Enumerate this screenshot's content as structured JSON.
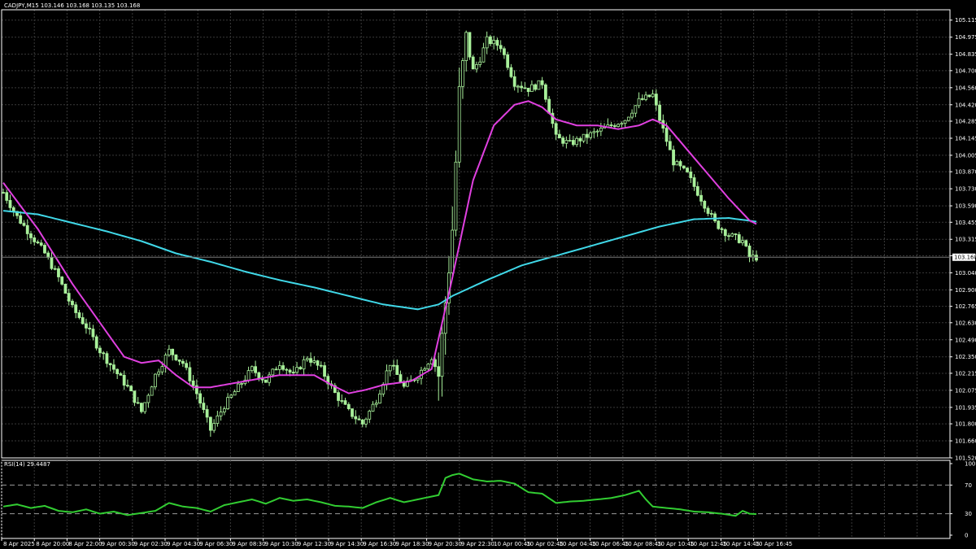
{
  "window": {
    "symbol_line": "CADJPY,M15  103.146 103.168 103.135 103.168",
    "rsi_line": "RSI(14) 29.4487",
    "last_price_label": "103.168"
  },
  "colors": {
    "background": "#000000",
    "grid": "#3a3a3a",
    "frame": "#ffffff",
    "candle": "#a8f09a",
    "sma_fast": "#e040e0",
    "sma_slow": "#40d8e8",
    "rsi": "#32cd32",
    "text": "#ffffff"
  },
  "chart_data": [
    {
      "type": "candlestick",
      "title": "CADJPY,M15",
      "ohlc_header": {
        "open": 103.146,
        "high": 103.168,
        "low": 103.135,
        "close": 103.168
      },
      "y_ticks": [
        "105.115",
        "104.975",
        "104.835",
        "104.700",
        "104.560",
        "104.420",
        "104.285",
        "104.145",
        "104.005",
        "103.870",
        "103.730",
        "103.590",
        "103.455",
        "103.315",
        "103.180",
        "103.040",
        "102.900",
        "102.765",
        "102.630",
        "102.490",
        "102.350",
        "102.215",
        "102.075",
        "101.935",
        "101.800",
        "101.660",
        "101.520"
      ],
      "ylim": [
        101.52,
        105.2
      ],
      "last_price": 103.168,
      "x_ticks": [
        "8 Apr 2025",
        "8 Apr 20:00",
        "8 Apr 22:00",
        "9 Apr 00:30",
        "9 Apr 02:30",
        "9 Apr 04:30",
        "9 Apr 06:30",
        "9 Apr 08:30",
        "9 Apr 10:30",
        "9 Apr 12:30",
        "9 Apr 14:30",
        "9 Apr 16:30",
        "9 Apr 18:30",
        "9 Apr 20:30",
        "9 Apr 22:30",
        "10 Apr 00:45",
        "10 Apr 02:45",
        "10 Apr 04:45",
        "10 Apr 06:45",
        "10 Apr 08:45",
        "10 Apr 10:45",
        "10 Apr 12:45",
        "10 Apr 14:45",
        "10 Apr 16:45"
      ],
      "close_path": [
        [
          0,
          103.7
        ],
        [
          4,
          103.5
        ],
        [
          8,
          103.35
        ],
        [
          12,
          103.2
        ],
        [
          16,
          103.0
        ],
        [
          20,
          102.75
        ],
        [
          24,
          102.6
        ],
        [
          28,
          102.4
        ],
        [
          32,
          102.25
        ],
        [
          36,
          102.1
        ],
        [
          40,
          101.9
        ],
        [
          44,
          102.2
        ],
        [
          48,
          102.4
        ],
        [
          52,
          102.3
        ],
        [
          56,
          102.05
        ],
        [
          60,
          101.75
        ],
        [
          64,
          101.95
        ],
        [
          68,
          102.1
        ],
        [
          72,
          102.25
        ],
        [
          76,
          102.15
        ],
        [
          80,
          102.3
        ],
        [
          84,
          102.2
        ],
        [
          88,
          102.35
        ],
        [
          92,
          102.25
        ],
        [
          96,
          102.05
        ],
        [
          100,
          101.9
        ],
        [
          104,
          101.8
        ],
        [
          108,
          102.0
        ],
        [
          112,
          102.3
        ],
        [
          116,
          102.1
        ],
        [
          120,
          102.2
        ],
        [
          124,
          102.35
        ],
        [
          126,
          102.2
        ],
        [
          130,
          103.4
        ],
        [
          132,
          104.5
        ],
        [
          134,
          104.95
        ],
        [
          136,
          104.7
        ],
        [
          138,
          104.8
        ],
        [
          140,
          104.95
        ],
        [
          144,
          104.9
        ],
        [
          148,
          104.6
        ],
        [
          152,
          104.55
        ],
        [
          156,
          104.6
        ],
        [
          160,
          104.15
        ],
        [
          164,
          104.1
        ],
        [
          168,
          104.15
        ],
        [
          172,
          104.2
        ],
        [
          176,
          104.25
        ],
        [
          180,
          104.3
        ],
        [
          184,
          104.45
        ],
        [
          188,
          104.5
        ],
        [
          190,
          104.3
        ],
        [
          194,
          103.95
        ],
        [
          198,
          103.85
        ],
        [
          202,
          103.65
        ],
        [
          206,
          103.45
        ],
        [
          210,
          103.35
        ],
        [
          214,
          103.3
        ],
        [
          216,
          103.17
        ],
        [
          218,
          103.168
        ]
      ],
      "series": [
        {
          "name": "SMA fast",
          "points": [
            [
              0,
              103.78
            ],
            [
              10,
              103.4
            ],
            [
              20,
              102.95
            ],
            [
              30,
              102.55
            ],
            [
              35,
              102.35
            ],
            [
              40,
              102.3
            ],
            [
              45,
              102.32
            ],
            [
              50,
              102.2
            ],
            [
              55,
              102.1
            ],
            [
              60,
              102.1
            ],
            [
              70,
              102.15
            ],
            [
              80,
              102.2
            ],
            [
              90,
              102.2
            ],
            [
              95,
              102.12
            ],
            [
              100,
              102.05
            ],
            [
              105,
              102.08
            ],
            [
              110,
              102.12
            ],
            [
              118,
              102.15
            ],
            [
              124,
              102.25
            ],
            [
              130,
              103.0
            ],
            [
              136,
              103.8
            ],
            [
              142,
              104.25
            ],
            [
              148,
              104.42
            ],
            [
              152,
              104.45
            ],
            [
              156,
              104.4
            ],
            [
              160,
              104.3
            ],
            [
              166,
              104.25
            ],
            [
              172,
              104.25
            ],
            [
              178,
              104.22
            ],
            [
              184,
              104.25
            ],
            [
              188,
              104.3
            ],
            [
              192,
              104.25
            ],
            [
              198,
              104.05
            ],
            [
              204,
              103.85
            ],
            [
              210,
              103.65
            ],
            [
              216,
              103.47
            ],
            [
              218,
              103.44
            ]
          ]
        },
        {
          "name": "SMA slow",
          "points": [
            [
              0,
              103.55
            ],
            [
              10,
              103.52
            ],
            [
              20,
              103.45
            ],
            [
              30,
              103.38
            ],
            [
              40,
              103.3
            ],
            [
              50,
              103.2
            ],
            [
              60,
              103.13
            ],
            [
              70,
              103.05
            ],
            [
              80,
              102.98
            ],
            [
              90,
              102.92
            ],
            [
              100,
              102.85
            ],
            [
              110,
              102.78
            ],
            [
              120,
              102.74
            ],
            [
              126,
              102.78
            ],
            [
              130,
              102.85
            ],
            [
              140,
              102.98
            ],
            [
              150,
              103.1
            ],
            [
              160,
              103.18
            ],
            [
              170,
              103.26
            ],
            [
              180,
              103.34
            ],
            [
              190,
              103.42
            ],
            [
              200,
              103.48
            ],
            [
              210,
              103.49
            ],
            [
              218,
              103.46
            ]
          ]
        }
      ]
    },
    {
      "type": "line",
      "title": "RSI(14) 29.4487",
      "y_ticks": [
        "100",
        "70",
        "30",
        "0"
      ],
      "ylim": [
        0,
        100
      ],
      "levels": [
        70,
        30
      ],
      "series": [
        {
          "name": "RSI(14)",
          "points": [
            [
              0,
              40
            ],
            [
              4,
              43
            ],
            [
              8,
              38
            ],
            [
              12,
              41
            ],
            [
              16,
              34
            ],
            [
              20,
              32
            ],
            [
              24,
              36
            ],
            [
              28,
              30
            ],
            [
              32,
              33
            ],
            [
              36,
              28
            ],
            [
              40,
              31
            ],
            [
              44,
              34
            ],
            [
              48,
              45
            ],
            [
              52,
              40
            ],
            [
              56,
              38
            ],
            [
              60,
              33
            ],
            [
              64,
              42
            ],
            [
              68,
              46
            ],
            [
              72,
              50
            ],
            [
              76,
              44
            ],
            [
              80,
              52
            ],
            [
              84,
              48
            ],
            [
              88,
              50
            ],
            [
              92,
              46
            ],
            [
              96,
              41
            ],
            [
              100,
              40
            ],
            [
              104,
              38
            ],
            [
              108,
              46
            ],
            [
              112,
              52
            ],
            [
              116,
              46
            ],
            [
              120,
              50
            ],
            [
              124,
              54
            ],
            [
              126,
              56
            ],
            [
              128,
              80
            ],
            [
              130,
              84
            ],
            [
              132,
              86
            ],
            [
              136,
              78
            ],
            [
              140,
              75
            ],
            [
              144,
              76
            ],
            [
              148,
              72
            ],
            [
              152,
              60
            ],
            [
              156,
              58
            ],
            [
              160,
              45
            ],
            [
              164,
              47
            ],
            [
              168,
              48
            ],
            [
              172,
              50
            ],
            [
              176,
              52
            ],
            [
              180,
              56
            ],
            [
              184,
              62
            ],
            [
              186,
              50
            ],
            [
              188,
              40
            ],
            [
              192,
              38
            ],
            [
              196,
              36
            ],
            [
              200,
              33
            ],
            [
              204,
              32
            ],
            [
              208,
              30
            ],
            [
              212,
              27
            ],
            [
              214,
              34
            ],
            [
              216,
              30
            ],
            [
              218,
              29.4
            ]
          ]
        }
      ]
    }
  ]
}
